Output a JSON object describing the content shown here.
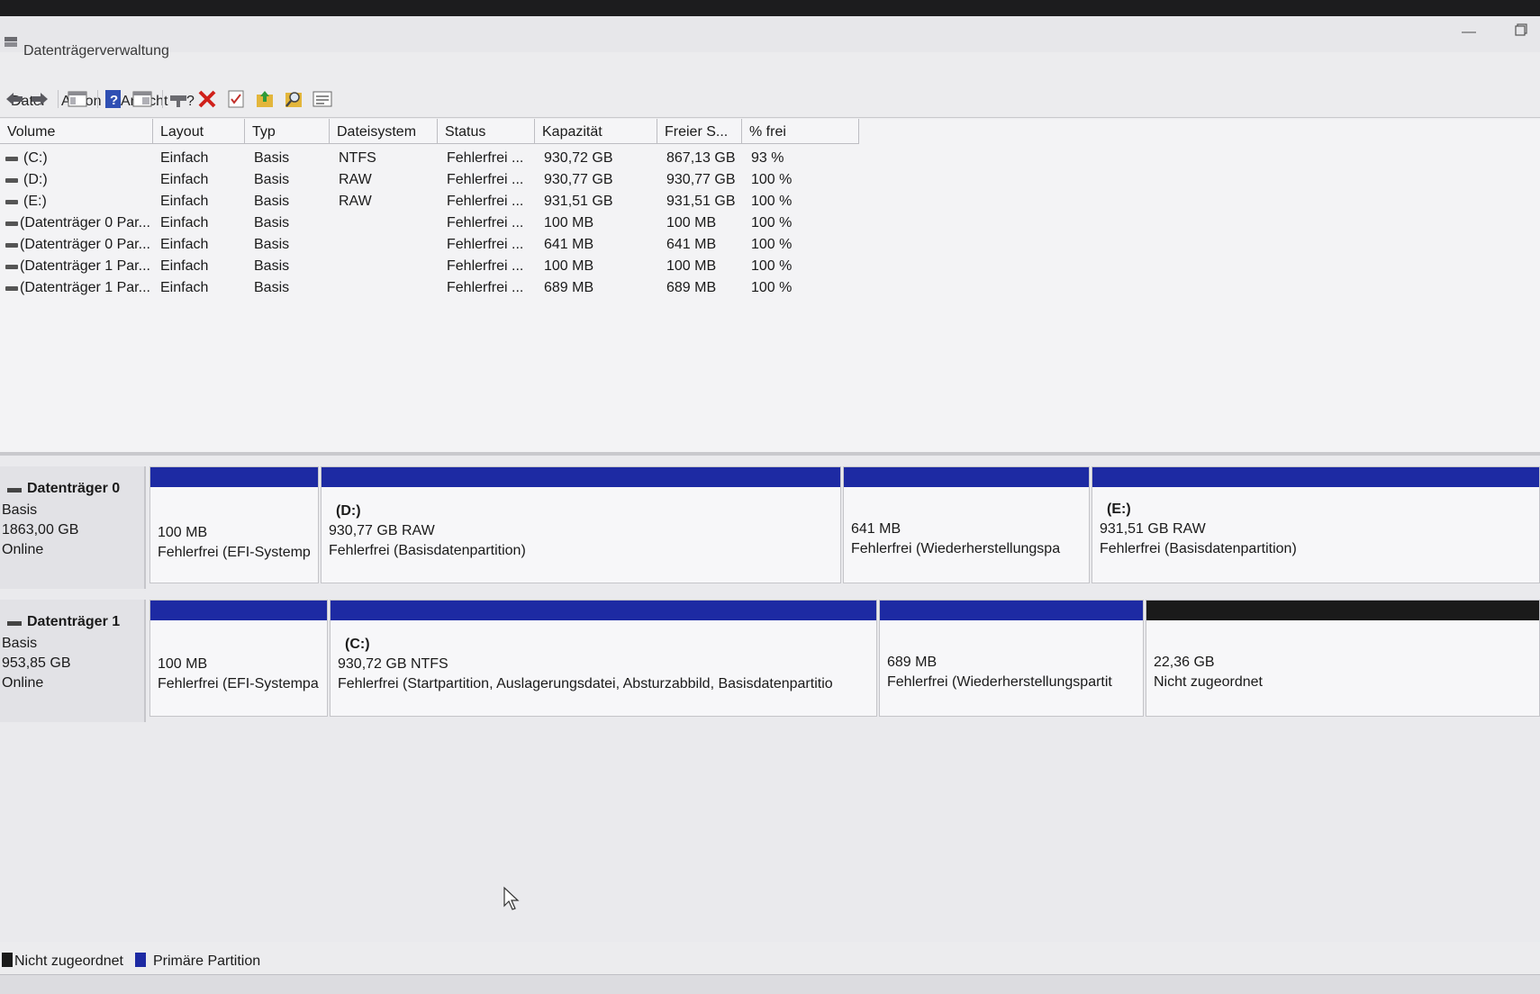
{
  "window": {
    "title": "Datenträgerverwaltung",
    "minimize_glyph": "—"
  },
  "menu": [
    {
      "label": "Datei"
    },
    {
      "label": "Aktion"
    },
    {
      "label": "Ansicht"
    },
    {
      "label": "?"
    }
  ],
  "toolbar": {
    "icons": [
      "back-icon",
      "forward-icon",
      "console-tree-icon",
      "help-icon",
      "properties-view-icon",
      "connect-disk-icon",
      "delete-icon",
      "check-icon",
      "folder-up-icon",
      "search-icon",
      "list-view-icon"
    ]
  },
  "volume_table": {
    "columns": [
      "Volume",
      "Layout",
      "Typ",
      "Dateisystem",
      "Status",
      "Kapazität",
      "Freier S...",
      "% frei"
    ],
    "rows": [
      [
        "(C:)",
        "Einfach",
        "Basis",
        "NTFS",
        "Fehlerfrei ...",
        "930,72 GB",
        "867,13 GB",
        "93 %"
      ],
      [
        "(D:)",
        "Einfach",
        "Basis",
        "RAW",
        "Fehlerfrei ...",
        "930,77 GB",
        "930,77 GB",
        "100 %"
      ],
      [
        "(E:)",
        "Einfach",
        "Basis",
        "RAW",
        "Fehlerfrei ...",
        "931,51 GB",
        "931,51 GB",
        "100 %"
      ],
      [
        "(Datenträger 0 Par...",
        "Einfach",
        "Basis",
        "",
        "Fehlerfrei ...",
        "100 MB",
        "100 MB",
        "100 %"
      ],
      [
        "(Datenträger 0 Par...",
        "Einfach",
        "Basis",
        "",
        "Fehlerfrei ...",
        "641 MB",
        "641 MB",
        "100 %"
      ],
      [
        "(Datenträger 1 Par...",
        "Einfach",
        "Basis",
        "",
        "Fehlerfrei ...",
        "100 MB",
        "100 MB",
        "100 %"
      ],
      [
        "(Datenträger 1 Par...",
        "Einfach",
        "Basis",
        "",
        "Fehlerfrei ...",
        "689 MB",
        "689 MB",
        "100 %"
      ]
    ]
  },
  "disks": [
    {
      "name": "Datenträger 0",
      "type": "Basis",
      "size": "1863,00 GB",
      "state": "Online",
      "partitions": [
        {
          "label": "",
          "size": "100 MB",
          "status": "Fehlerfrei (EFI-Systemp"
        },
        {
          "label": "(D:)",
          "size": "930,77 GB RAW",
          "status": "Fehlerfrei (Basisdatenpartition)"
        },
        {
          "label": "",
          "size": "641 MB",
          "status": "Fehlerfrei (Wiederherstellungspa"
        },
        {
          "label": "(E:)",
          "size": "931,51 GB RAW",
          "status": "Fehlerfrei (Basisdatenpartition)"
        }
      ]
    },
    {
      "name": "Datenträger 1",
      "type": "Basis",
      "size": "953,85 GB",
      "state": "Online",
      "partitions": [
        {
          "label": "",
          "size": "100 MB",
          "status": "Fehlerfrei (EFI-Systempa"
        },
        {
          "label": "(C:)",
          "size": "930,72 GB NTFS",
          "status": "Fehlerfrei (Startpartition, Auslagerungsdatei, Absturzabbild, Basisdatenpartitio"
        },
        {
          "label": "",
          "size": "689 MB",
          "status": "Fehlerfrei (Wiederherstellungspartit"
        },
        {
          "label": "",
          "size": "22,36 GB",
          "status": "Nicht zugeordnet"
        }
      ]
    }
  ],
  "legend": [
    {
      "label": "Nicht zugeordnet",
      "color": "#1a1a1a"
    },
    {
      "label": "Primäre Partition",
      "color": "#1d2aa3"
    }
  ]
}
